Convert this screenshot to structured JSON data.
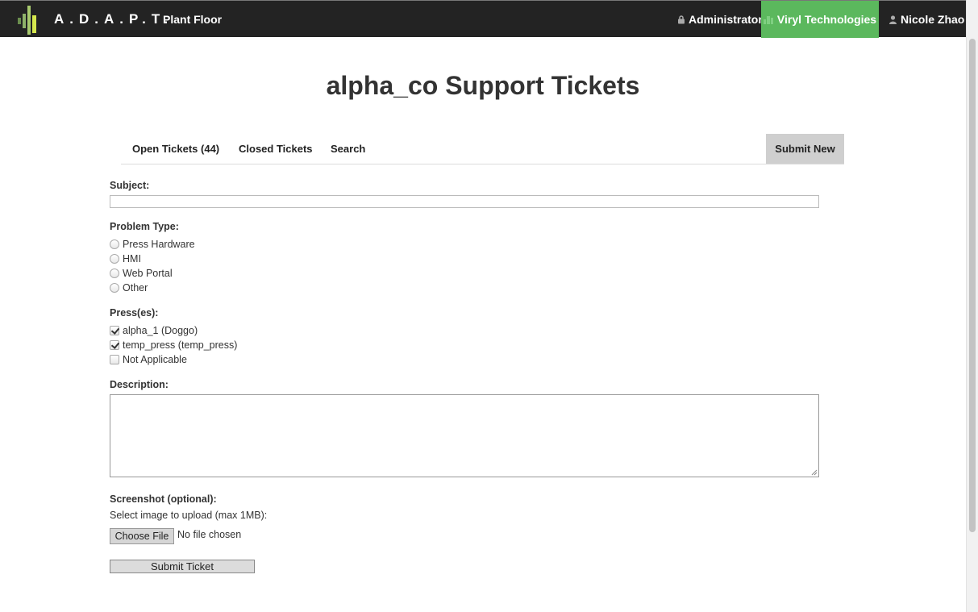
{
  "nav": {
    "brand": "A.D.A.P.T.",
    "plant_floor": "Plant Floor",
    "admin": "Administrator",
    "company": "Viryl Technologies",
    "user": "Nicole Zhao",
    "accent_color": "#5bb85d"
  },
  "page": {
    "title": "alpha_co Support Tickets"
  },
  "tabs": {
    "open": "Open Tickets (44)",
    "closed": "Closed Tickets",
    "search": "Search",
    "submit_new": "Submit New"
  },
  "form": {
    "subject_label": "Subject:",
    "subject_value": "",
    "problem_type_label": "Problem Type:",
    "problem_types": [
      "Press Hardware",
      "HMI",
      "Web Portal",
      "Other"
    ],
    "presses_label": "Press(es):",
    "presses": [
      {
        "label": "alpha_1 (Doggo)",
        "checked": true
      },
      {
        "label": "temp_press (temp_press)",
        "checked": true
      },
      {
        "label": "Not Applicable",
        "checked": false
      }
    ],
    "description_label": "Description:",
    "screenshot_label": "Screenshot (optional):",
    "screenshot_hint": "Select image to upload (max 1MB):",
    "choose_file": "Choose File",
    "no_file": "No file chosen",
    "submit": "Submit Ticket"
  },
  "icons": {
    "logo": "adapt-logo-icon",
    "lock": "lock-icon",
    "company": "building-icon",
    "user": "user-icon"
  }
}
